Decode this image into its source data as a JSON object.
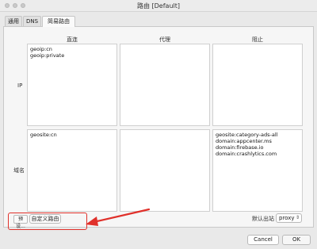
{
  "window": {
    "title": "路由 [Default]"
  },
  "tabs": [
    {
      "label": "通用"
    },
    {
      "label": "DNS"
    },
    {
      "label": "简易路由"
    }
  ],
  "columns": {
    "direct": "直连",
    "proxy": "代理",
    "block": "阻止"
  },
  "rows": {
    "ip": "IP",
    "domain": "域名"
  },
  "ip_direct": [
    "geoip:cn",
    "geoip:private"
  ],
  "ip_proxy": [],
  "ip_block": [],
  "domain_direct": [
    "geosite:cn"
  ],
  "domain_proxy": [],
  "domain_block": [
    "geosite:category-ads-all",
    "domain:appcenter.ms",
    "domain:firebase.io",
    "domain:crashlytics.com"
  ],
  "footer": {
    "preset_button": "预设...",
    "custom_route_button": "自定义路由",
    "default_outbound_label": "默认出站",
    "default_outbound_value": "proxy",
    "cancel_button": "Cancel",
    "ok_button": "OK"
  },
  "colors": {
    "highlight": "#e0302a"
  }
}
